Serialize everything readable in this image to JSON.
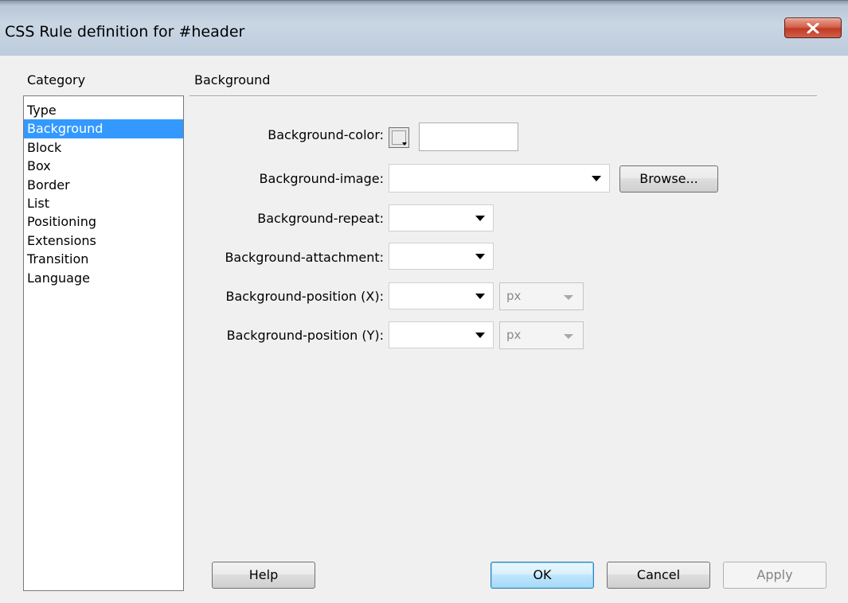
{
  "window": {
    "title": "CSS Rule definition for #header",
    "close_icon": "close-icon"
  },
  "category": {
    "label": "Category",
    "selected": "Background",
    "items": [
      "Type",
      "Background",
      "Block",
      "Box",
      "Border",
      "List",
      "Positioning",
      "Extensions",
      "Transition",
      "Language"
    ]
  },
  "panel": {
    "title": "Background",
    "fields": {
      "bg_color": {
        "label": "Background-color:",
        "value": ""
      },
      "bg_image": {
        "label": "Background-image:",
        "value": "",
        "browse_label": "Browse..."
      },
      "bg_repeat": {
        "label": "Background-repeat:",
        "value": ""
      },
      "bg_attachment": {
        "label": "Background-attachment:",
        "value": ""
      },
      "bg_pos_x": {
        "label": "Background-position (X):",
        "value": "",
        "unit": "px"
      },
      "bg_pos_y": {
        "label": "Background-position (Y):",
        "value": "",
        "unit": "px"
      }
    }
  },
  "buttons": {
    "help": "Help",
    "ok": "OK",
    "cancel": "Cancel",
    "apply": "Apply"
  },
  "colors": {
    "selection": "#3399ff",
    "close_button": "#c9472f",
    "default_button_border": "#3c7fb1"
  }
}
